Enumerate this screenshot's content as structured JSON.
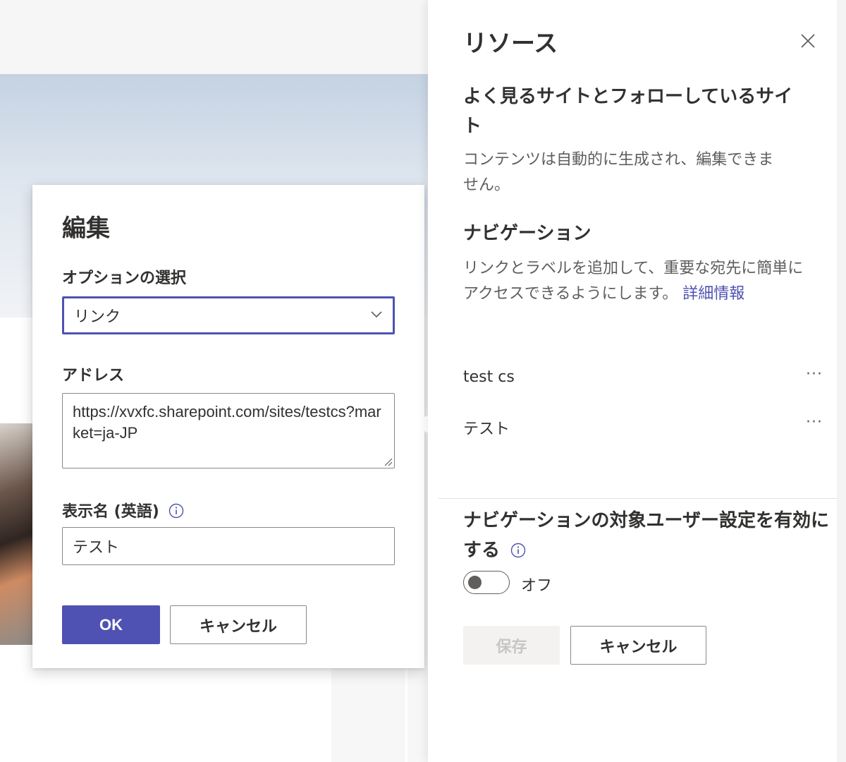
{
  "edit_callout": {
    "title": "編集",
    "option_label": "オプションの選択",
    "option_value": "リンク",
    "address_label": "アドレス",
    "address_value": "https://xvxfc.sharepoint.com/sites/testcs?market=ja-JP",
    "display_name_label": "表示名 (英語)",
    "display_name_value": "テスト",
    "ok_label": "OK",
    "cancel_label": "キャンセル"
  },
  "panel": {
    "title": "リソース",
    "frequent_heading": "よく見るサイトとフォローしているサイト",
    "frequent_text": "コンテンツは自動的に生成され、編集できません。",
    "nav_heading": "ナビゲーション",
    "nav_text": "リンクとラベルを追加して、重要な宛先に簡単にアクセスできるようにします。",
    "nav_link": "詳細情報",
    "nav_items": [
      {
        "label": "test cs",
        "more": "···"
      },
      {
        "label": "テスト",
        "more": "···"
      }
    ],
    "audience_heading": "ナビゲーションの対象ユーザー設定を有効にする",
    "toggle_state": "オフ",
    "save_label": "保存",
    "cancel_label": "キャンセル"
  },
  "colors": {
    "accent": "#4f52b2",
    "text": "#323130",
    "secondary_text": "#605e5c"
  },
  "icons": [
    "chevron-down-icon",
    "info-icon",
    "close-icon",
    "more-icon"
  ]
}
